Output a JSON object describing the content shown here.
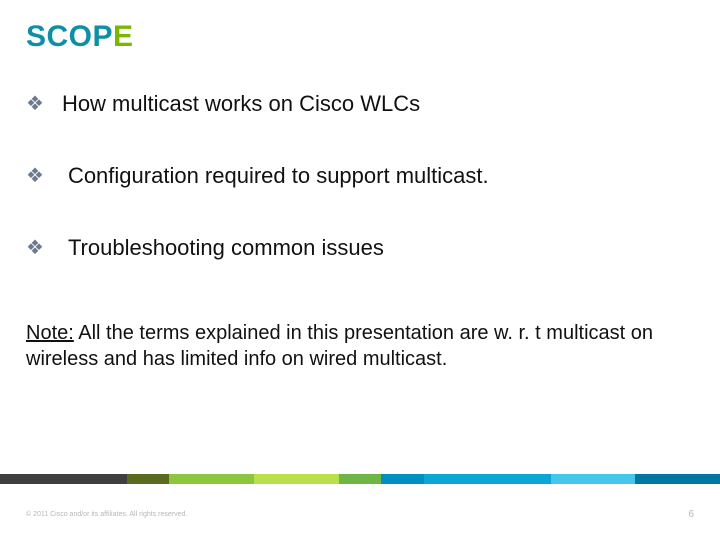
{
  "title": {
    "main": "SCOP",
    "accent": "E"
  },
  "bullets": [
    "How multicast works on Cisco WLCs",
    "Configuration required to support multicast.",
    "Troubleshooting common issues"
  ],
  "note": {
    "label": "Note:",
    "text": " All the terms explained in this presentation are w. r. t multicast on wireless and has limited info on wired multicast."
  },
  "footer": {
    "copyright": "© 2011 Cisco and/or its affiliates. All rights reserved.",
    "page": "6"
  }
}
